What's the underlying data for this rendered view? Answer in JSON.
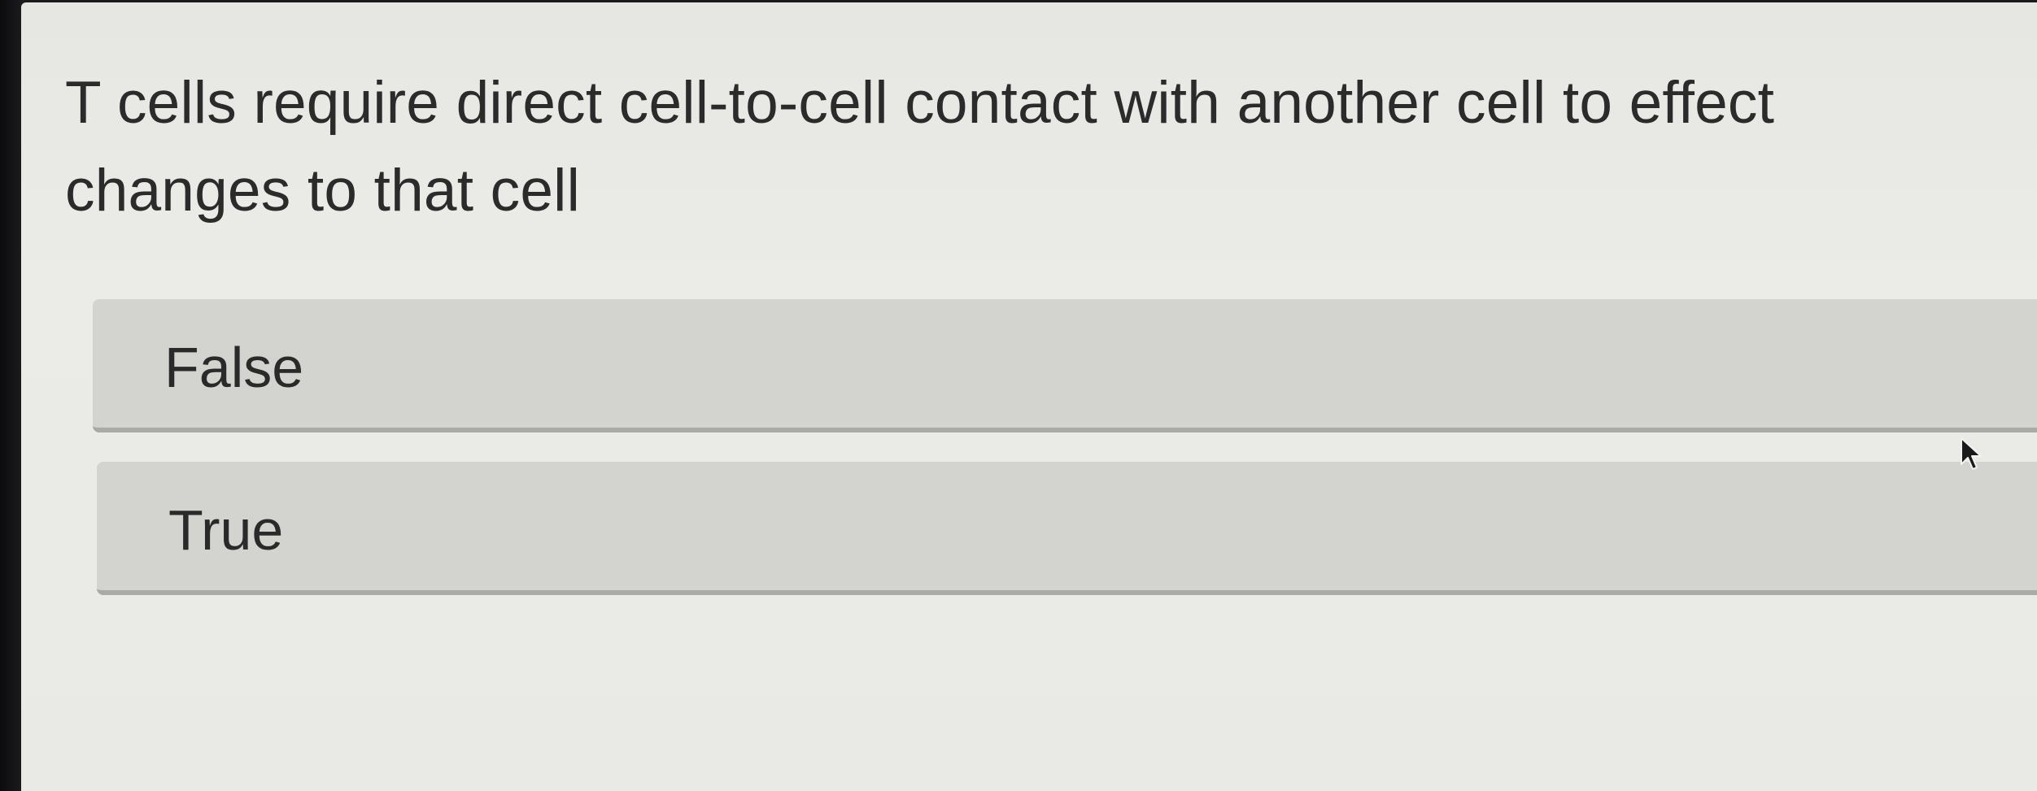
{
  "question": {
    "text": "T cells require direct cell-to-cell contact with another cell to effect changes to that cell"
  },
  "options": [
    {
      "label": "False"
    },
    {
      "label": "True"
    }
  ],
  "icons": {
    "cursor": "mouse-pointer-icon"
  },
  "colors": {
    "background": "#e9e9e5",
    "option_fill": "#d3d3cf",
    "option_shadow": "#a9a9a5",
    "text": "#2b2b2b"
  }
}
